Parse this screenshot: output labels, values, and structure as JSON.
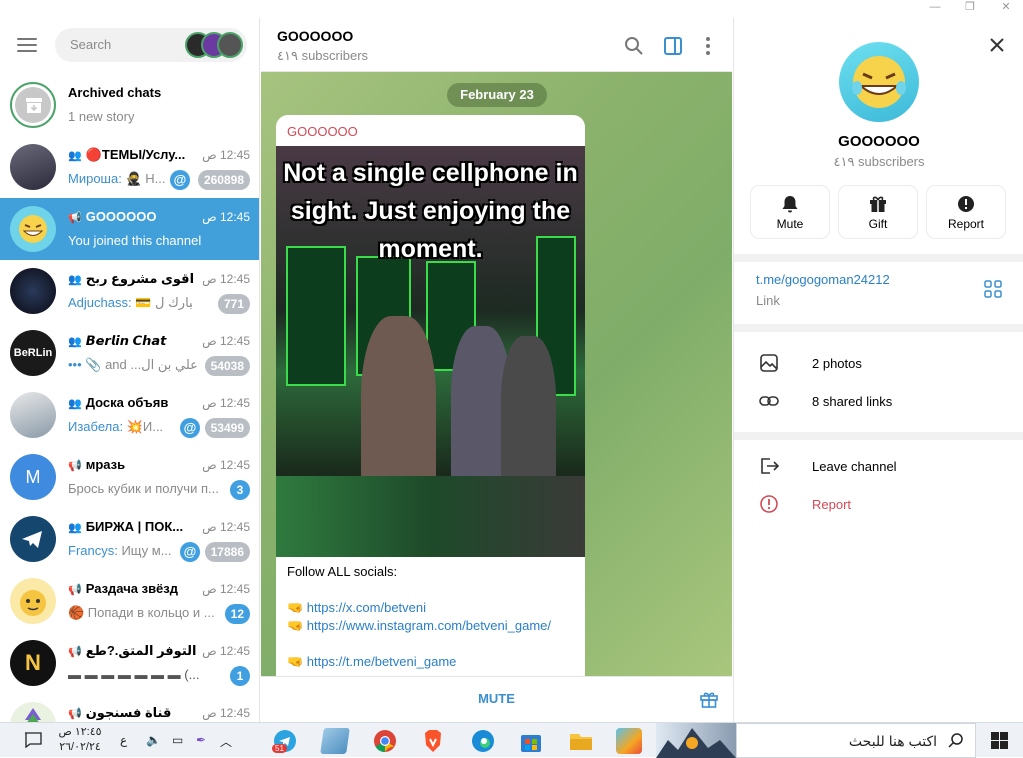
{
  "window": {
    "minimize": "—",
    "maximize": "❐",
    "close": "✕"
  },
  "sidebar": {
    "search_placeholder": "Search",
    "chats": [
      {
        "name": "Archived chats",
        "time": "",
        "preview_who": "",
        "preview": "1 new story",
        "badge": "",
        "avatar": "archive",
        "kind": "archive"
      },
      {
        "name": "🔴ТЕМЫ/Услу...",
        "time": "12:45 ص",
        "preview_who": "Мироша:",
        "preview": " 🥷 Н...",
        "badge": "260898",
        "mention": true,
        "avatar": "photo",
        "kind": "group"
      },
      {
        "name": "GOOOOOO",
        "time": "12:45 ص",
        "preview_who": "",
        "preview": "You joined this channel",
        "badge": "",
        "avatar": "laugh",
        "kind": "channel",
        "active": true
      },
      {
        "name": "اقوى مشروع ربح ...",
        "time": "12:45 ص",
        "preview_who": "Adjuchass:",
        "preview": " 💳 مبارك ل ...",
        "badge": "771",
        "avatar": "dark",
        "kind": "group"
      },
      {
        "name": "𝘽𝙚𝙧𝙡𝙞𝙣 𝘾𝙝𝙖𝙩",
        "time": "12:45 ص",
        "preview_who": "•••",
        "preview": " 📎 and ...علي بن ال",
        "badge": "54038",
        "avatar": "berlin",
        "kind": "group"
      },
      {
        "name": "Доска объяв",
        "time": "12:45 ص",
        "preview_who": "Изабела:",
        "preview": " 💥И...",
        "badge": "53499",
        "mention": true,
        "avatar": "hands",
        "kind": "group"
      },
      {
        "name": "мразь",
        "time": "12:45 ص",
        "preview_who": "",
        "preview": "Брось кубик и получи п...",
        "badge": "3",
        "badge_blue": true,
        "avatar": "M",
        "kind": "channel"
      },
      {
        "name": "БИРЖА | ПОК...",
        "time": "12:45 ص",
        "preview_who": "Francys:",
        "preview": " Ищу м...",
        "badge": "17886",
        "mention": true,
        "avatar": "telegram",
        "kind": "group"
      },
      {
        "name": "Раздача звёзд",
        "time": "12:45 ص",
        "preview_who": "",
        "preview": "🏀 Попади в кольцо и ...",
        "badge": "12",
        "badge_blue": true,
        "avatar": "cartoon",
        "kind": "channel"
      },
      {
        "name": "التوفر المتق.?طع ...",
        "time": "12:45 ص",
        "preview_who": "",
        "preview": "▬ ▬ ▬ ▬ ▬ ▬ ▬ (...",
        "badge": "1",
        "badge_blue": true,
        "avatar": "number",
        "kind": "channel"
      },
      {
        "name": "قناة فسنجون",
        "time": "12:45 ص",
        "preview_who": "",
        "preview": "",
        "badge": "",
        "avatar": "tree",
        "kind": "channel"
      }
    ]
  },
  "chat": {
    "title": "GOOOOOO",
    "subtitle": "٤١٩ subscribers",
    "date": "February 23",
    "post_author": "GOOOOOO",
    "photo_caption": "Not a single cellphone in sight. Just enjoying the moment.",
    "text": "Follow ALL socials:",
    "links": [
      "🤜 https://x.com/betveni",
      "🤜  https://www.instagram.com/betveni_game/",
      "🤜 https://t.me/betveni_game"
    ],
    "mute_label": "MUTE"
  },
  "profile": {
    "name": "GOOOOOO",
    "subtitle": "٤١٩ subscribers",
    "actions": [
      "Mute",
      "Gift",
      "Report"
    ],
    "link": "t.me/gogogoman24212",
    "link_label": "Link",
    "media": [
      "2 photos",
      "8 shared links"
    ],
    "leave": "Leave channel",
    "report": "Report"
  },
  "taskbar": {
    "search_placeholder": "اكتب هنا للبحث",
    "time": "١٢:٤٥ ص",
    "date": "٢٦/٠٢/٢٤",
    "lang": "ع",
    "telegram_badge": "51"
  },
  "colors": {
    "accent": "#419fd9",
    "danger": "#d24a55",
    "link": "#2a7fc8"
  }
}
